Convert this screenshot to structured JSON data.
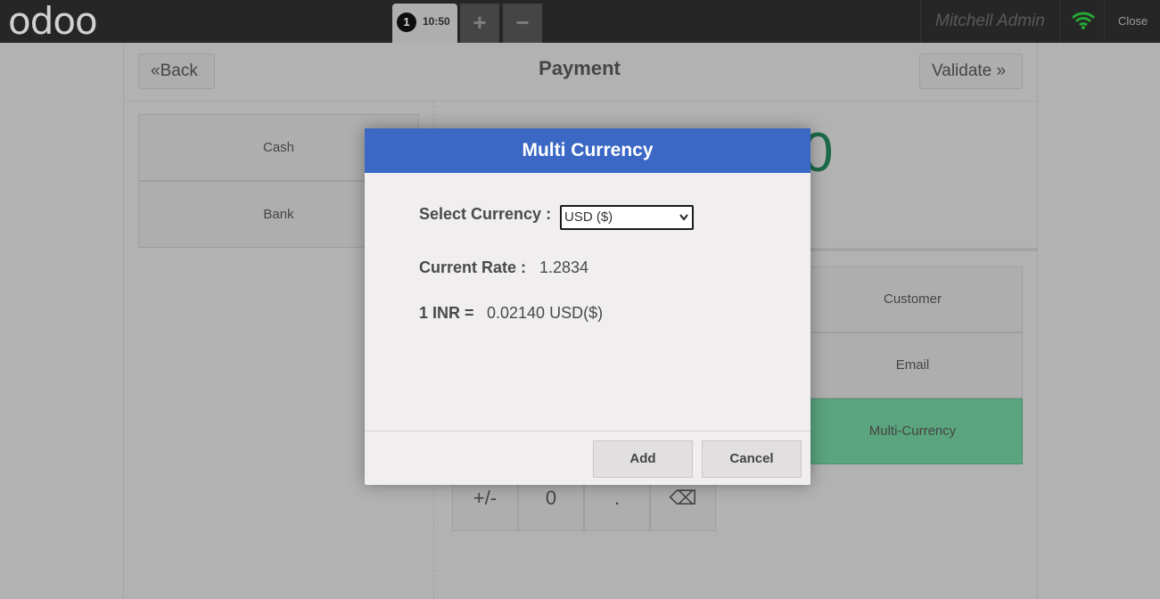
{
  "topbar": {
    "logo": "odoo",
    "order": {
      "number": "1",
      "time": "10:50"
    },
    "add_label": "+",
    "remove_label": "−",
    "user": "Mitchell Admin",
    "close_label": "Close",
    "wifi_color": "#2ecc40"
  },
  "payment": {
    "title": "Payment",
    "back_label": "Back",
    "validate_label": "Validate",
    "methods": [
      "Cash",
      "Bank"
    ],
    "total_fragment": "0",
    "side_buttons": [
      "Customer",
      "Email",
      "Multi-Currency"
    ],
    "keys": [
      "+/-",
      "0",
      ".",
      "⌫"
    ],
    "accent_color": "#23805a",
    "active_color": "#6ec89b"
  },
  "modal": {
    "title": "Multi Currency",
    "header_color": "#3b68c4",
    "currency_label": "Select Currency :",
    "currency_selected": "USD ($)",
    "rate_label": "Current Rate :",
    "rate_value": "1.2834",
    "conversion_label": "1 INR =",
    "conversion_value": "0.02140 USD($)",
    "add_label": "Add",
    "cancel_label": "Cancel"
  }
}
